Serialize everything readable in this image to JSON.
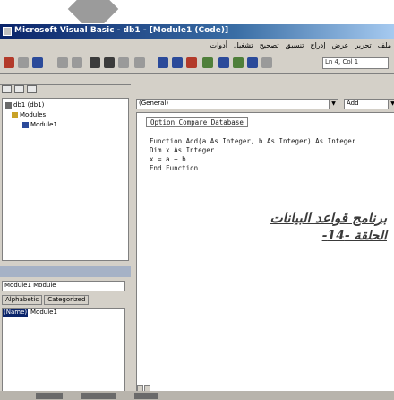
{
  "window": {
    "title": "Microsoft Visual Basic - db1 - [Module1 (Code)]"
  },
  "menu": {
    "items": [
      "ملف",
      "تحرير",
      "عرض",
      "إدراج",
      "تنسيق",
      "تصحيح",
      "تشغيل",
      "أدوات"
    ]
  },
  "toolbar": {
    "position_label": "Ln 4, Col 1"
  },
  "project": {
    "tree": [
      {
        "label": "db1 (db1)"
      },
      {
        "label": "Modules"
      },
      {
        "label": "Module1"
      }
    ]
  },
  "properties": {
    "object_combo": "Module1 Module",
    "tabs": [
      "Alphabetic",
      "Categorized"
    ],
    "row_name": "(Name)",
    "row_value": "Module1"
  },
  "code": {
    "object_combo": "(General)",
    "proc_combo": "Add",
    "lines": [
      "Option Compare Database",
      "Function Add(a As Integer, b As Integer) As Integer",
      "Dim x As Integer",
      "x = a + b",
      "End Function"
    ]
  },
  "overlay": {
    "line1": "برنامج قواعد البيانات",
    "line2": "الحلقة -14-"
  },
  "colors": {
    "titlebar_start": "#0a246a",
    "titlebar_end": "#a6caf0",
    "chrome": "#d4d0c8",
    "overlay_text": "#3a3a3a"
  }
}
